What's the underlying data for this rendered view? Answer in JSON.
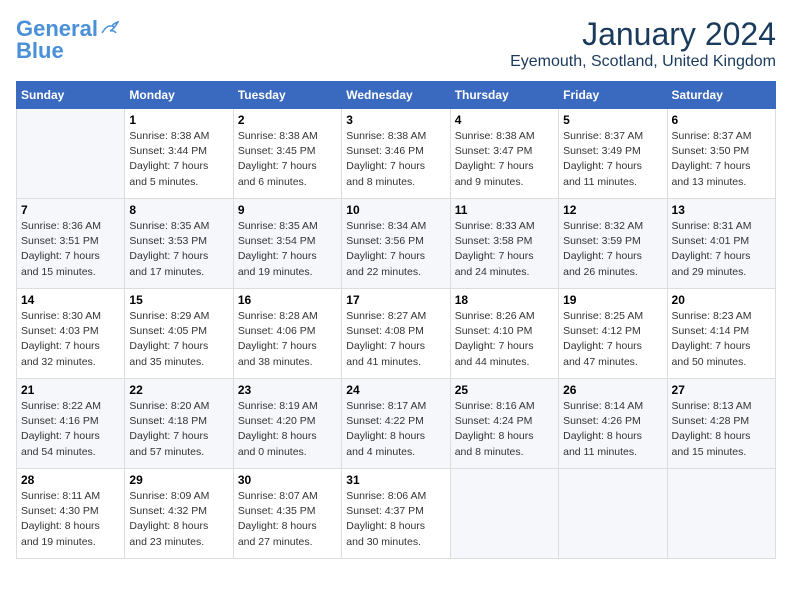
{
  "logo": {
    "text_general": "General",
    "text_blue": "Blue"
  },
  "title": "January 2024",
  "subtitle": "Eyemouth, Scotland, United Kingdom",
  "days_of_week": [
    "Sunday",
    "Monday",
    "Tuesday",
    "Wednesday",
    "Thursday",
    "Friday",
    "Saturday"
  ],
  "weeks": [
    [
      {
        "day": "",
        "info": ""
      },
      {
        "day": "1",
        "info": "Sunrise: 8:38 AM\nSunset: 3:44 PM\nDaylight: 7 hours\nand 5 minutes."
      },
      {
        "day": "2",
        "info": "Sunrise: 8:38 AM\nSunset: 3:45 PM\nDaylight: 7 hours\nand 6 minutes."
      },
      {
        "day": "3",
        "info": "Sunrise: 8:38 AM\nSunset: 3:46 PM\nDaylight: 7 hours\nand 8 minutes."
      },
      {
        "day": "4",
        "info": "Sunrise: 8:38 AM\nSunset: 3:47 PM\nDaylight: 7 hours\nand 9 minutes."
      },
      {
        "day": "5",
        "info": "Sunrise: 8:37 AM\nSunset: 3:49 PM\nDaylight: 7 hours\nand 11 minutes."
      },
      {
        "day": "6",
        "info": "Sunrise: 8:37 AM\nSunset: 3:50 PM\nDaylight: 7 hours\nand 13 minutes."
      }
    ],
    [
      {
        "day": "7",
        "info": "Sunrise: 8:36 AM\nSunset: 3:51 PM\nDaylight: 7 hours\nand 15 minutes."
      },
      {
        "day": "8",
        "info": "Sunrise: 8:35 AM\nSunset: 3:53 PM\nDaylight: 7 hours\nand 17 minutes."
      },
      {
        "day": "9",
        "info": "Sunrise: 8:35 AM\nSunset: 3:54 PM\nDaylight: 7 hours\nand 19 minutes."
      },
      {
        "day": "10",
        "info": "Sunrise: 8:34 AM\nSunset: 3:56 PM\nDaylight: 7 hours\nand 22 minutes."
      },
      {
        "day": "11",
        "info": "Sunrise: 8:33 AM\nSunset: 3:58 PM\nDaylight: 7 hours\nand 24 minutes."
      },
      {
        "day": "12",
        "info": "Sunrise: 8:32 AM\nSunset: 3:59 PM\nDaylight: 7 hours\nand 26 minutes."
      },
      {
        "day": "13",
        "info": "Sunrise: 8:31 AM\nSunset: 4:01 PM\nDaylight: 7 hours\nand 29 minutes."
      }
    ],
    [
      {
        "day": "14",
        "info": "Sunrise: 8:30 AM\nSunset: 4:03 PM\nDaylight: 7 hours\nand 32 minutes."
      },
      {
        "day": "15",
        "info": "Sunrise: 8:29 AM\nSunset: 4:05 PM\nDaylight: 7 hours\nand 35 minutes."
      },
      {
        "day": "16",
        "info": "Sunrise: 8:28 AM\nSunset: 4:06 PM\nDaylight: 7 hours\nand 38 minutes."
      },
      {
        "day": "17",
        "info": "Sunrise: 8:27 AM\nSunset: 4:08 PM\nDaylight: 7 hours\nand 41 minutes."
      },
      {
        "day": "18",
        "info": "Sunrise: 8:26 AM\nSunset: 4:10 PM\nDaylight: 7 hours\nand 44 minutes."
      },
      {
        "day": "19",
        "info": "Sunrise: 8:25 AM\nSunset: 4:12 PM\nDaylight: 7 hours\nand 47 minutes."
      },
      {
        "day": "20",
        "info": "Sunrise: 8:23 AM\nSunset: 4:14 PM\nDaylight: 7 hours\nand 50 minutes."
      }
    ],
    [
      {
        "day": "21",
        "info": "Sunrise: 8:22 AM\nSunset: 4:16 PM\nDaylight: 7 hours\nand 54 minutes."
      },
      {
        "day": "22",
        "info": "Sunrise: 8:20 AM\nSunset: 4:18 PM\nDaylight: 7 hours\nand 57 minutes."
      },
      {
        "day": "23",
        "info": "Sunrise: 8:19 AM\nSunset: 4:20 PM\nDaylight: 8 hours\nand 0 minutes."
      },
      {
        "day": "24",
        "info": "Sunrise: 8:17 AM\nSunset: 4:22 PM\nDaylight: 8 hours\nand 4 minutes."
      },
      {
        "day": "25",
        "info": "Sunrise: 8:16 AM\nSunset: 4:24 PM\nDaylight: 8 hours\nand 8 minutes."
      },
      {
        "day": "26",
        "info": "Sunrise: 8:14 AM\nSunset: 4:26 PM\nDaylight: 8 hours\nand 11 minutes."
      },
      {
        "day": "27",
        "info": "Sunrise: 8:13 AM\nSunset: 4:28 PM\nDaylight: 8 hours\nand 15 minutes."
      }
    ],
    [
      {
        "day": "28",
        "info": "Sunrise: 8:11 AM\nSunset: 4:30 PM\nDaylight: 8 hours\nand 19 minutes."
      },
      {
        "day": "29",
        "info": "Sunrise: 8:09 AM\nSunset: 4:32 PM\nDaylight: 8 hours\nand 23 minutes."
      },
      {
        "day": "30",
        "info": "Sunrise: 8:07 AM\nSunset: 4:35 PM\nDaylight: 8 hours\nand 27 minutes."
      },
      {
        "day": "31",
        "info": "Sunrise: 8:06 AM\nSunset: 4:37 PM\nDaylight: 8 hours\nand 30 minutes."
      },
      {
        "day": "",
        "info": ""
      },
      {
        "day": "",
        "info": ""
      },
      {
        "day": "",
        "info": ""
      }
    ]
  ]
}
